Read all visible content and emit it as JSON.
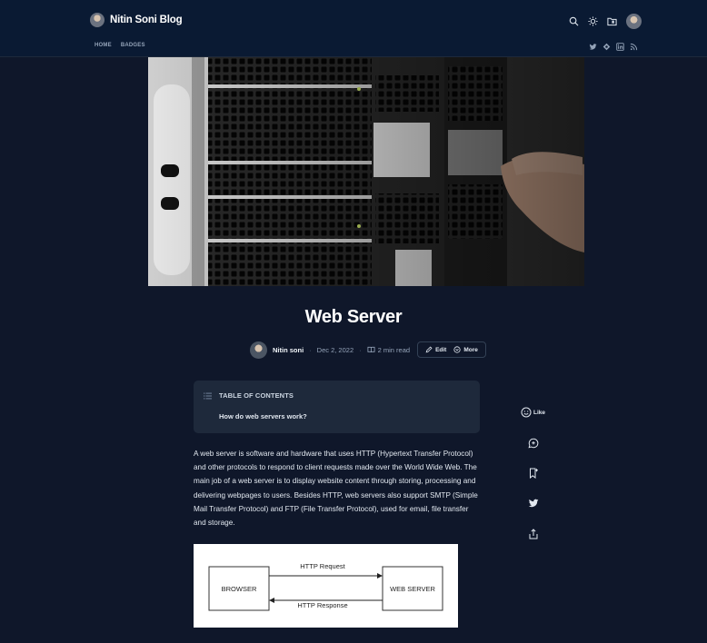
{
  "header": {
    "blog_name": "Nitin Soni Blog",
    "nav": [
      "HOME",
      "BADGES"
    ],
    "icons": [
      "search-icon",
      "sun-icon",
      "bookmark-folder-icon",
      "avatar"
    ],
    "social_icons": [
      "twitter-icon",
      "hashnode-icon",
      "linkedin-icon",
      "rss-icon"
    ]
  },
  "post": {
    "title": "Web Server",
    "author": "Nitin soni",
    "date": "Dec 2, 2022",
    "read_time": "2 min read",
    "edit_label": "Edit",
    "more_label": "More"
  },
  "toc": {
    "heading": "TABLE OF CONTENTS",
    "items": [
      "How do web servers work?"
    ]
  },
  "sidebar": {
    "like_label": "Like",
    "icons": [
      "like-icon",
      "comment-icon",
      "bookmark-icon",
      "twitter-icon",
      "share-icon"
    ]
  },
  "content": {
    "paragraph": "A web server is software and hardware that uses HTTP (Hypertext Transfer Protocol) and other protocols to respond to client requests made over the World Wide Web. The main job of a web server is to display website content through storing, processing and delivering webpages to users. Besides HTTP, web servers also support SMTP (Simple Mail Transfer Protocol) and FTP (File Transfer Protocol), used for email, file transfer and storage."
  },
  "diagram": {
    "left_box": "BROWSER",
    "right_box": "WEB SERVER",
    "request": "HTTP Request",
    "response": "HTTP Response"
  },
  "colors": {
    "background": "#0f172a",
    "header": "#0a1a33",
    "card": "#1e293b",
    "text": "#e2e8f0"
  }
}
